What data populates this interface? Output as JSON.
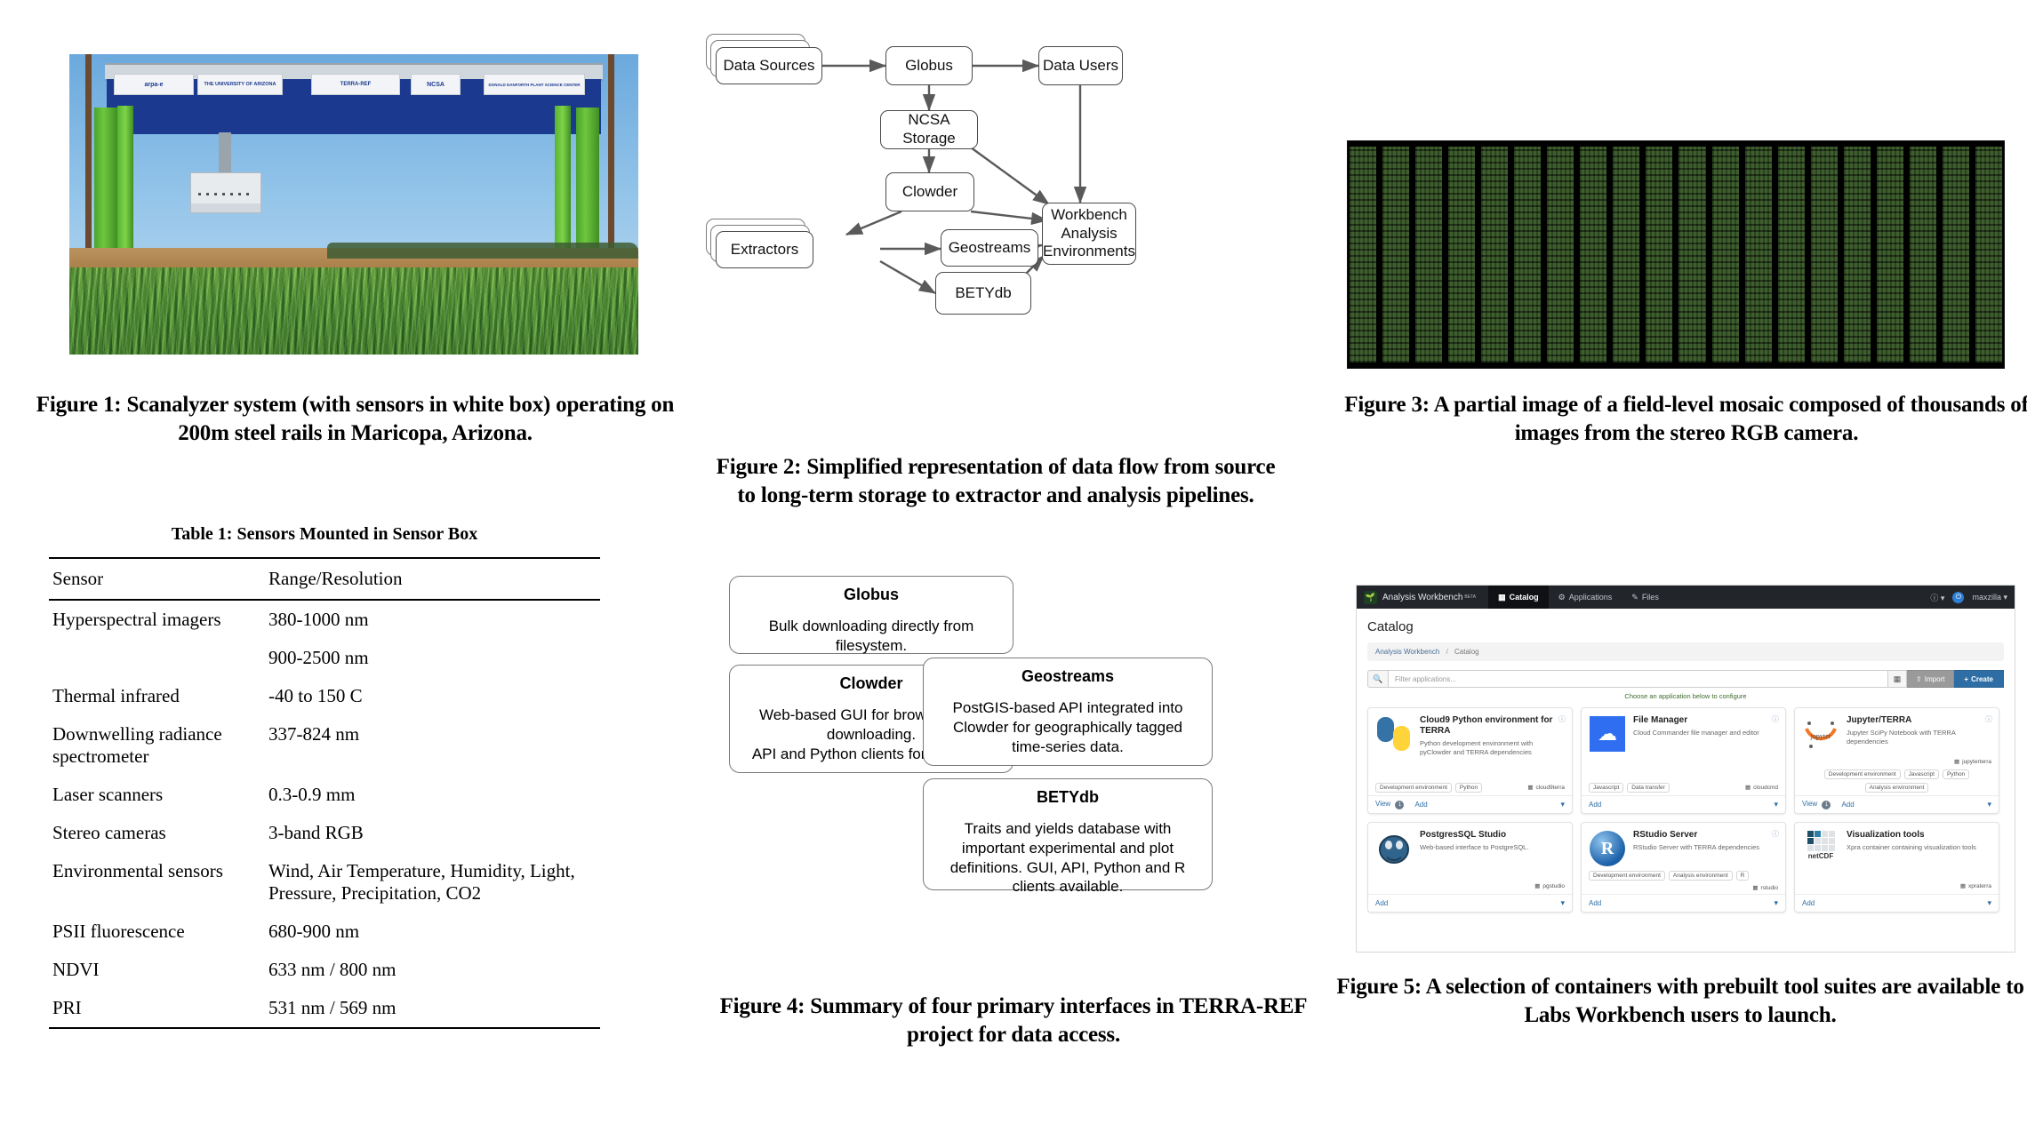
{
  "figure1": {
    "caption": "Figure 1: Scanalyzer system (with sensors in white box) operating on 200m steel rails in Maricopa, Arizona.",
    "banners": [
      "arpa-e",
      "THE UNIVERSITY OF ARIZONA",
      "TERRA-REF",
      "NCSA",
      "DONALD DANFORTH PLANT SCIENCE CENTER"
    ]
  },
  "table1": {
    "title": "Table 1: Sensors Mounted in Sensor Box",
    "headers": [
      "Sensor",
      "Range/Resolution"
    ],
    "rows": [
      {
        "sensor": "Hyperspectral imagers",
        "range": "380-1000 nm"
      },
      {
        "sensor": "",
        "range": "900-2500 nm"
      },
      {
        "sensor": "Thermal infrared",
        "range": "-40 to 150 C"
      },
      {
        "sensor": "Downwelling radiance spectrometer",
        "range": "337-824 nm"
      },
      {
        "sensor": "Laser scanners",
        "range": "0.3-0.9 mm"
      },
      {
        "sensor": "Stereo cameras",
        "range": "3-band RGB"
      },
      {
        "sensor": "Environmental sensors",
        "range": "Wind, Air Temperature, Humidity, Light, Pressure, Precipitation, CO2"
      },
      {
        "sensor": "PSII fluorescence",
        "range": "680-900 nm"
      },
      {
        "sensor": "NDVI",
        "range": "633 nm / 800 nm"
      },
      {
        "sensor": "PRI",
        "range": "531 nm / 569 nm"
      }
    ]
  },
  "figure2": {
    "caption": "Figure 2: Simplified representation of data flow from source to long-term storage to extractor and analysis pipelines.",
    "nodes": [
      {
        "id": "data-sources",
        "label": "Data Sources",
        "stacked": true
      },
      {
        "id": "globus",
        "label": "Globus",
        "stacked": false
      },
      {
        "id": "data-users",
        "label": "Data Users",
        "stacked": false
      },
      {
        "id": "ncsa-storage",
        "label": "NCSA Storage",
        "stacked": false
      },
      {
        "id": "clowder",
        "label": "Clowder",
        "stacked": false
      },
      {
        "id": "extractors",
        "label": "Extractors",
        "stacked": true
      },
      {
        "id": "geostreams",
        "label": "Geostreams",
        "stacked": false
      },
      {
        "id": "betydb",
        "label": "BETYdb",
        "stacked": false
      },
      {
        "id": "workbench",
        "label": "Workbench Analysis Environments",
        "stacked": false
      }
    ],
    "edges": [
      {
        "from": "data-sources",
        "to": "globus"
      },
      {
        "from": "globus",
        "to": "data-users"
      },
      {
        "from": "globus",
        "to": "ncsa-storage"
      },
      {
        "from": "ncsa-storage",
        "to": "clowder"
      },
      {
        "from": "ncsa-storage",
        "to": "workbench"
      },
      {
        "from": "clowder",
        "to": "extractors"
      },
      {
        "from": "clowder",
        "to": "workbench"
      },
      {
        "from": "data-users",
        "to": "workbench"
      },
      {
        "from": "extractors",
        "to": "geostreams"
      },
      {
        "from": "extractors",
        "to": "betydb"
      },
      {
        "from": "geostreams",
        "to": "workbench"
      },
      {
        "from": "betydb",
        "to": "workbench"
      }
    ]
  },
  "figure3": {
    "caption": "Figure 3: A partial image of a field-level mosaic composed of thousands of images from the stereo RGB camera."
  },
  "figure4": {
    "caption": "Figure 4: Summary of four primary interfaces in TERRA-REF project for data access.",
    "boxes": [
      {
        "title": "Globus",
        "body": "Bulk downloading directly from filesystem."
      },
      {
        "title": "Clowder",
        "body": "Web-based GUI for browsing and downloading.\nAPI and Python clients for scripting."
      },
      {
        "title": "Geostreams",
        "body": "PostGIS-based API integrated into Clowder for geographically tagged time-series data."
      },
      {
        "title": "BETYdb",
        "body": "Traits and yields database with important experimental and plot definitions. GUI, API, Python and R clients available."
      }
    ]
  },
  "figure5": {
    "caption": "Figure 5: A selection of containers with prebuilt tool suites are available to Labs Workbench users to launch.",
    "ui": {
      "brand": "Analysis Workbench",
      "brand_badge": "BETA",
      "nav": [
        {
          "label": "Catalog",
          "icon": "grid-icon",
          "active": true
        },
        {
          "label": "Applications",
          "icon": "apps-icon",
          "active": false
        },
        {
          "label": "Files",
          "icon": "file-icon",
          "active": false
        }
      ],
      "help_label": "?",
      "user": "maxzilla",
      "page_title": "Catalog",
      "breadcrumb": {
        "root": "Analysis Workbench",
        "sep": "/",
        "current": "Catalog"
      },
      "search_placeholder": "Filter applications...",
      "import_label": "Import",
      "create_label": "Create",
      "hint": "Choose an application below to configure",
      "cards": [
        {
          "title": "Cloud9 Python environment for TERRA",
          "desc": "Python development environment with pyClowder and TERRA dependencies",
          "icon": "python-icon",
          "tags": [
            "Development environment",
            "Python"
          ],
          "key": "cloud9terra",
          "actions": [
            "View",
            "Add"
          ],
          "view_count": "1"
        },
        {
          "title": "File Manager",
          "desc": "Cloud Commander file manager and editor",
          "icon": "cloud-file-icon",
          "tags": [
            "Javascript",
            "Data transfer"
          ],
          "key": "cloudcmd",
          "actions": [
            "Add"
          ],
          "view_count": ""
        },
        {
          "title": "Jupyter/TERRA",
          "desc": "Jupyter SciPy Notebook with TERRA dependencies",
          "icon": "jupyter-icon",
          "tags": [
            "Development environment",
            "Javascript",
            "Python",
            "Analysis environment"
          ],
          "key": "jupyterterra",
          "actions": [
            "View",
            "Add"
          ],
          "view_count": "1"
        },
        {
          "title": "PostgresSQL Studio",
          "desc": "Web-based interface to PostgreSQL.",
          "icon": "postgres-icon",
          "tags": [],
          "key": "pgstudio",
          "actions": [
            "Add"
          ],
          "view_count": ""
        },
        {
          "title": "RStudio Server",
          "desc": "RStudio Server with TERRA dependencies",
          "icon": "rstudio-icon",
          "tags": [
            "Development environment",
            "Analysis environment",
            "R"
          ],
          "key": "rstudio",
          "actions": [
            "Add"
          ],
          "view_count": ""
        },
        {
          "title": "Visualization tools",
          "desc": "Xpra container containing visualization tools",
          "icon": "netcdf-icon",
          "tags": [],
          "key": "xpraterra",
          "actions": [
            "Add"
          ],
          "view_count": ""
        }
      ]
    }
  },
  "colors": {
    "header_bg": "#22252a",
    "accent_blue": "#2f6ea5",
    "hint_green": "#3c6b2a",
    "gantry_blue": "#1b3a8f",
    "gantry_green": "#5fbb33"
  }
}
